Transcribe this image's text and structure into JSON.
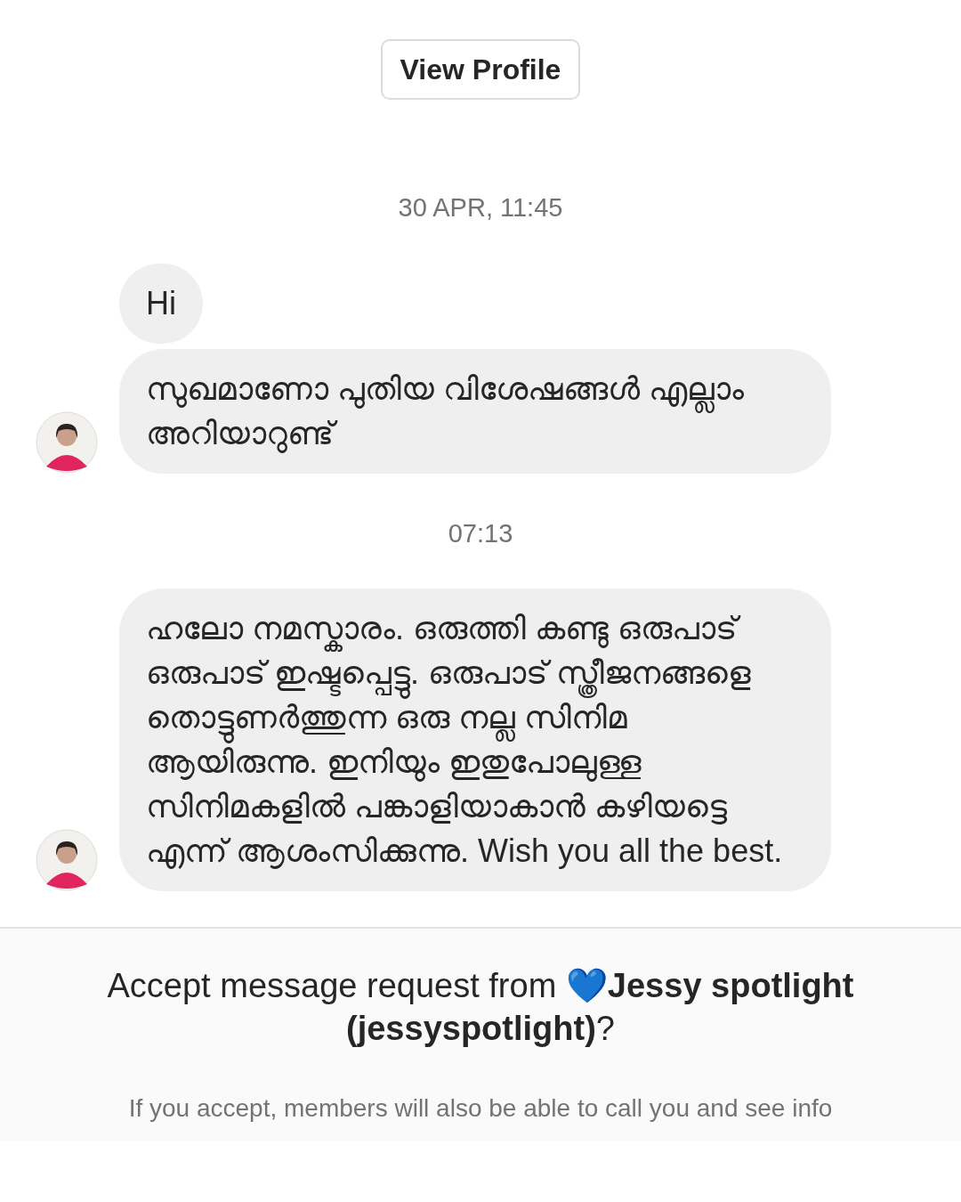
{
  "view_profile_button": "View Profile",
  "thread": [
    {
      "kind": "timestamp",
      "text": "30 APR, 11:45"
    },
    {
      "kind": "message",
      "text": "Hi",
      "show_avatar": false
    },
    {
      "kind": "message",
      "text": "സുഖമാണോ പുതിയ വിശേഷങ്ങൾ എല്ലാം അറിയാറുണ്ട്",
      "show_avatar": true
    },
    {
      "kind": "timestamp",
      "text": "07:13"
    },
    {
      "kind": "message",
      "text": "ഹലോ നമസ്കാരം. ഒരുത്തി കണ്ടു ഒരുപാട് ഒരുപാട് ഇഷ്ടപ്പെട്ടു. ഒരുപാട് സ്ത്രീജനങ്ങളെ തൊട്ടുണർത്തുന്ന ഒരു നല്ല സിനിമ ആയിരുന്നു. ഇനിയും ഇതുപോലുള്ള സിനിമകളിൽ പങ്കാളിയാകാൻ കഴിയട്ടെ എന്ന് ആശംസിക്കുന്നു. Wish you all the best.",
      "show_avatar": true
    }
  ],
  "request": {
    "title": "Accept message request from **💙Jessy spotlight (jessyspotlight)**?",
    "info": "If you accept, members will also be able to call you and see info"
  }
}
